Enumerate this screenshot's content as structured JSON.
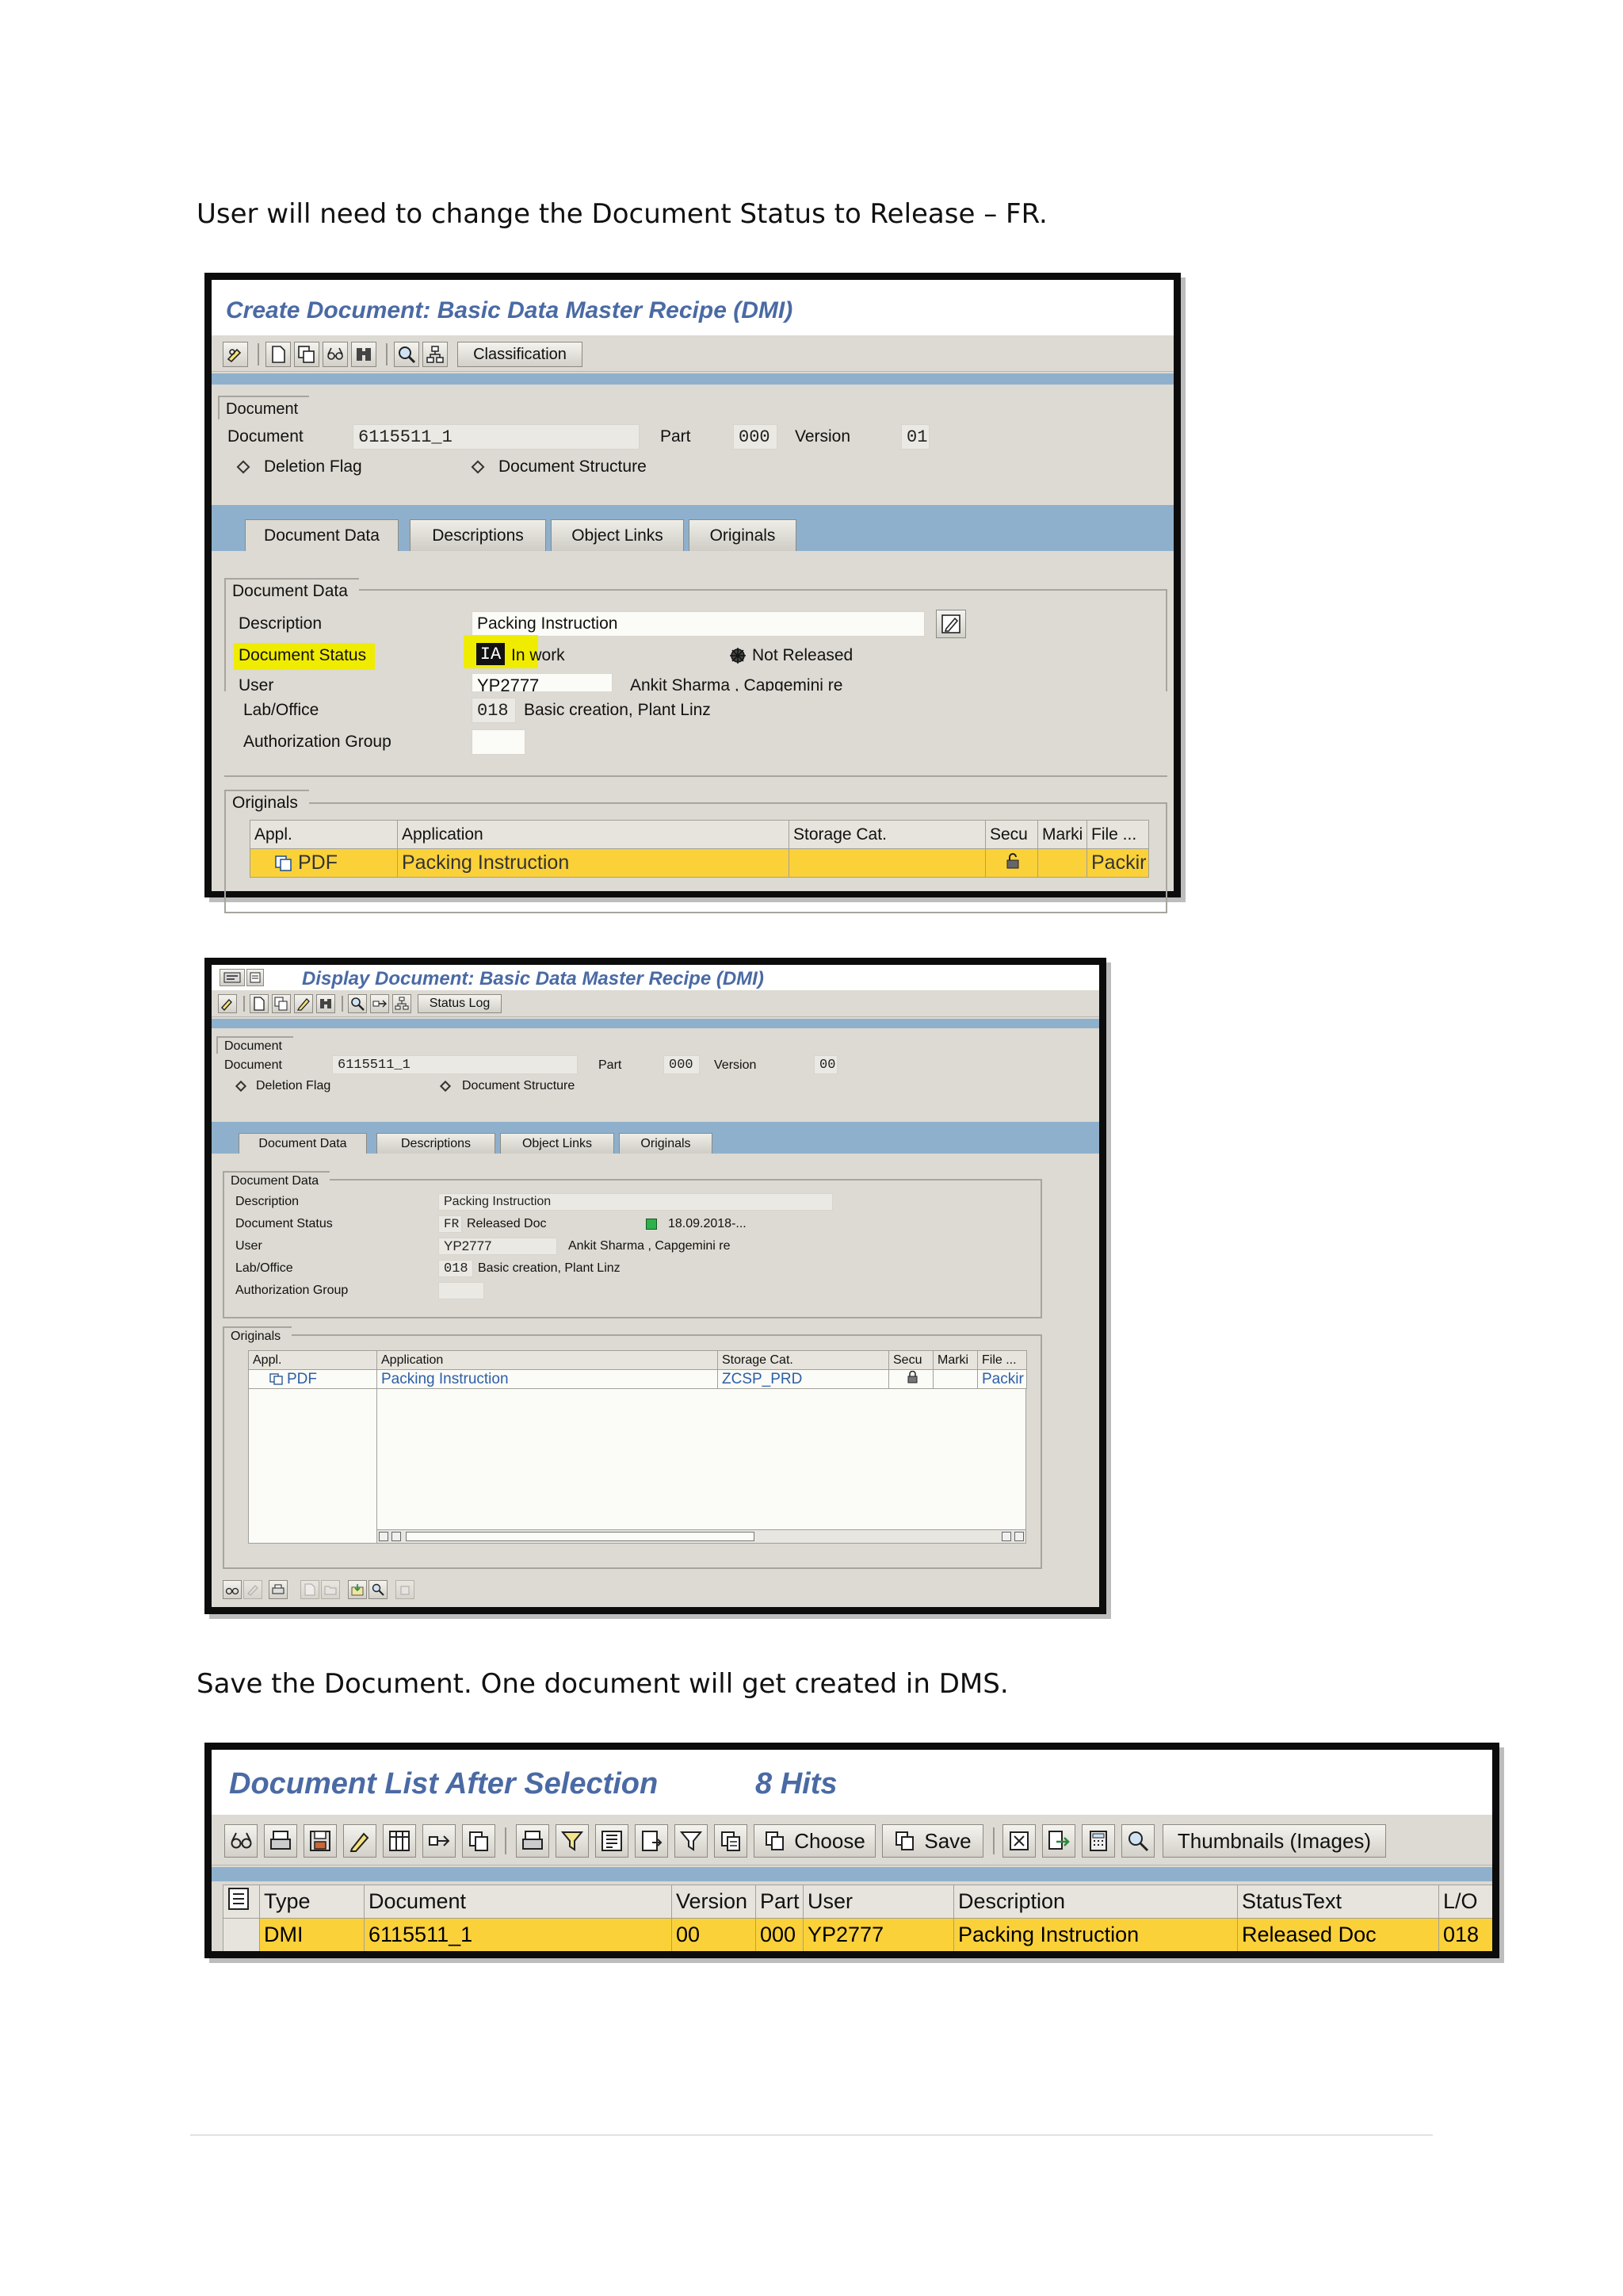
{
  "instructions": {
    "change_status": "User will need to change the Document Status to Release – FR.",
    "save_doc": "Save the Document. One document will get created in DMS."
  },
  "create_screen": {
    "title": "Create Document: Basic Data Master Recipe (DMI)",
    "toolbar_classification": "Classification",
    "document_section": "Document",
    "document_label": "Document",
    "document_value": "6115511_1",
    "part_label": "Part",
    "part_value": "000",
    "version_label": "Version",
    "version_value": "01",
    "deletion_flag": "Deletion Flag",
    "document_structure": "Document Structure",
    "tabs": [
      "Document Data",
      "Descriptions",
      "Object Links",
      "Originals"
    ],
    "data_section": "Document Data",
    "description_label": "Description",
    "description_value": "Packing Instruction",
    "status_label": "Document Status",
    "status_code": "IA",
    "status_text": "In work",
    "release_text": "Not Released",
    "user_label": "User",
    "user_value": "YP2777",
    "user_name": "Ankit Sharma , Capgemini re",
    "lab_label": "Lab/Office",
    "lab_code": "018",
    "lab_text": "Basic creation, Plant Linz",
    "auth_label": "Authorization Group",
    "originals_section": "Originals",
    "originals_headers": [
      "Appl.",
      "Application",
      "Storage Cat.",
      "Secu",
      "Marki",
      "File ..."
    ],
    "originals_row": {
      "appl": "PDF",
      "application": "Packing Instruction",
      "storage": "",
      "file": "Packir"
    }
  },
  "display_screen": {
    "title": "Display Document: Basic Data Master Recipe (DMI)",
    "toolbar_status_log": "Status Log",
    "document_section": "Document",
    "document_label": "Document",
    "document_value": "6115511_1",
    "part_label": "Part",
    "part_value": "000",
    "version_label": "Version",
    "version_value": "00",
    "deletion_flag": "Deletion Flag",
    "document_structure": "Document Structure",
    "tabs": [
      "Document Data",
      "Descriptions",
      "Object Links",
      "Originals"
    ],
    "data_section": "Document Data",
    "description_label": "Description",
    "description_value": "Packing Instruction",
    "status_label": "Document Status",
    "status_code": "FR",
    "status_text": "Released Doc",
    "status_date": "18.09.2018-...",
    "user_label": "User",
    "user_value": "YP2777",
    "user_name": "Ankit Sharma , Capgemini re",
    "lab_label": "Lab/Office",
    "lab_code": "018",
    "lab_text": "Basic creation, Plant Linz",
    "auth_label": "Authorization Group",
    "originals_section": "Originals",
    "originals_headers": [
      "Appl.",
      "Application",
      "Storage Cat.",
      "Secu",
      "Marki",
      "File ..."
    ],
    "originals_row": {
      "appl": "PDF",
      "application": "Packing Instruction",
      "storage": "ZCSP_PRD",
      "file": "Packir"
    }
  },
  "list_screen": {
    "title": "Document List After Selection",
    "hits": "8 Hits",
    "choose": "Choose",
    "save": "Save",
    "thumbnails": "Thumbnails (Images)",
    "headers": [
      "Type",
      "Document",
      "Version",
      "Part",
      "User",
      "Description",
      "StatusText",
      "L/O"
    ],
    "row": [
      "DMI",
      "6115511_1",
      "00",
      "000",
      "YP2777",
      "Packing Instruction",
      "Released Doc",
      "018"
    ]
  },
  "colors": {
    "title_blue": "#4a6aa4",
    "highlight_yellow": "#f0ec00",
    "row_yellow": "#fbd13a",
    "sap_gray": "#dcdad2",
    "sap_blue_bar": "#8fb0cc"
  }
}
